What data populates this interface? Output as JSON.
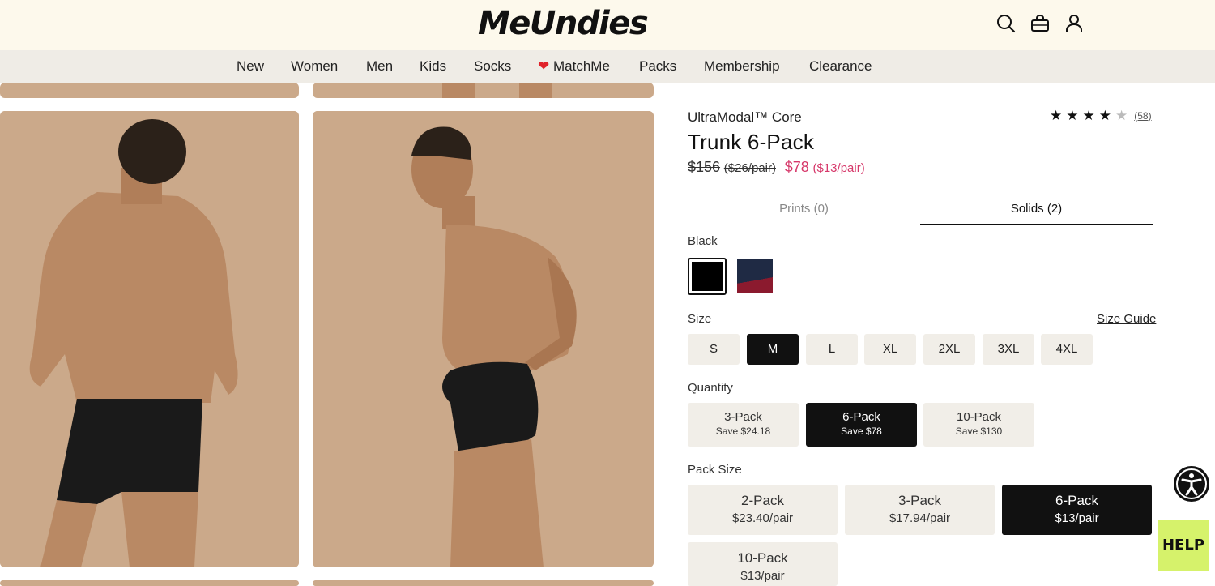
{
  "brand": {
    "logo_text": "MeUndies"
  },
  "header": {
    "icons": [
      "search-icon",
      "bag-icon",
      "user-icon"
    ]
  },
  "nav": {
    "items": [
      "New",
      "Women",
      "Men",
      "Kids",
      "Socks",
      "MatchMe",
      "Packs",
      "Membership",
      "Clearance"
    ],
    "matchme_icon": "heart-icon"
  },
  "product": {
    "eyebrow": "UltraModal™ Core",
    "title": "Trunk 6-Pack",
    "price_original": "$156",
    "price_original_per_pair": "($26/pair)",
    "price_sale": "$78",
    "price_sale_per_pair": "($13/pair)",
    "rating_stars": 4.5,
    "review_count": "(58)"
  },
  "tabs": {
    "prints": "Prints (0)",
    "solids": "Solids (2)",
    "active": "solids"
  },
  "color": {
    "selected_label": "Black",
    "swatches": [
      {
        "name": "Black",
        "color": "#000000",
        "selected": true
      },
      {
        "name": "Navy/Red",
        "color_top": "#1f2a44",
        "color_bottom": "#8b1a2e",
        "selected": false
      }
    ]
  },
  "size": {
    "label": "Size",
    "guide_link": "Size Guide",
    "options": [
      "S",
      "M",
      "L",
      "XL",
      "2XL",
      "3XL",
      "4XL"
    ],
    "selected": "M"
  },
  "quantity": {
    "label": "Quantity",
    "options": [
      {
        "name": "3-Pack",
        "save": "Save $24.18",
        "selected": false
      },
      {
        "name": "6-Pack",
        "save": "Save $78",
        "selected": true
      },
      {
        "name": "10-Pack",
        "save": "Save $130",
        "selected": false
      }
    ]
  },
  "pack_size": {
    "label": "Pack Size",
    "options": [
      {
        "name": "2-Pack",
        "price": "$23.40/pair",
        "selected": false
      },
      {
        "name": "3-Pack",
        "price": "$17.94/pair",
        "selected": false
      },
      {
        "name": "6-Pack",
        "price": "$13/pair",
        "selected": true
      },
      {
        "name": "10-Pack",
        "price": "$13/pair",
        "selected": false
      }
    ]
  },
  "widgets": {
    "help_label": "HELP",
    "accessibility_icon": "accessibility-icon"
  },
  "colors": {
    "header_bg": "#fdf9ec",
    "nav_bg": "#efece6",
    "sale": "#d6386a",
    "help_bg": "#d6f26b",
    "photo_bg": "#cba98a"
  }
}
